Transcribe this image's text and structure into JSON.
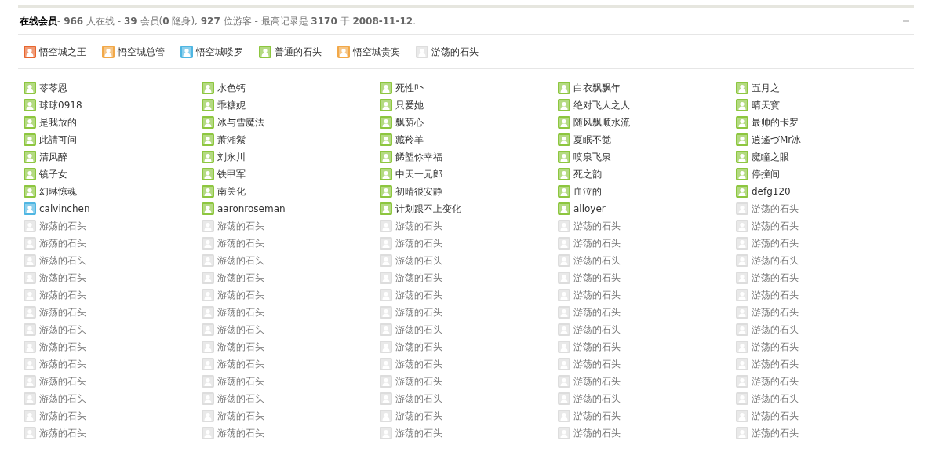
{
  "header": {
    "title": "在线会员",
    "summary": " - **966** 人在线 - **39** 会员(**0** 隐身), **927** 位游客 - 最高记录是 **3170** 于 **2008-11-12**."
  },
  "legend": [
    {
      "label": "悟空城之王",
      "color": "#e8662e"
    },
    {
      "label": "悟空城总管",
      "color": "#f2a848"
    },
    {
      "label": "悟空城喽罗",
      "color": "#4fb6e2"
    },
    {
      "label": "普通的石头",
      "color": "#8dc63f"
    },
    {
      "label": "悟空城贵宾",
      "color": "#f2a848"
    },
    {
      "label": "游荡的石头",
      "color": "#dddddd"
    }
  ],
  "members": [
    {
      "name": "苓苓恩",
      "color": "#8dc63f"
    },
    {
      "name": "水色钙",
      "color": "#8dc63f"
    },
    {
      "name": "死性卟",
      "color": "#8dc63f"
    },
    {
      "name": "白衣飘飘年",
      "color": "#8dc63f"
    },
    {
      "name": "五月之",
      "color": "#8dc63f"
    },
    {
      "name": "球球0918",
      "color": "#8dc63f"
    },
    {
      "name": "乖糖妮",
      "color": "#8dc63f"
    },
    {
      "name": "只爱她",
      "color": "#8dc63f"
    },
    {
      "name": "绝对飞人之人",
      "color": "#8dc63f"
    },
    {
      "name": "晴天寳",
      "color": "#8dc63f"
    },
    {
      "name": "是我放的",
      "color": "#8dc63f"
    },
    {
      "name": "冰与雪魔法",
      "color": "#8dc63f"
    },
    {
      "name": "飘荫心",
      "color": "#8dc63f"
    },
    {
      "name": "随风飘顺水流",
      "color": "#8dc63f"
    },
    {
      "name": "最帅的卡罗",
      "color": "#8dc63f"
    },
    {
      "name": "此請可问",
      "color": "#8dc63f"
    },
    {
      "name": "萧湘紫",
      "color": "#8dc63f"
    },
    {
      "name": "藏羚羊",
      "color": "#8dc63f"
    },
    {
      "name": "夏眠不觉",
      "color": "#8dc63f"
    },
    {
      "name": "逍遙づMr冰",
      "color": "#8dc63f"
    },
    {
      "name": "清风醉",
      "color": "#8dc63f"
    },
    {
      "name": "刘永川",
      "color": "#8dc63f"
    },
    {
      "name": "餙塱伱幸福",
      "color": "#8dc63f"
    },
    {
      "name": "喷泉飞泉",
      "color": "#8dc63f"
    },
    {
      "name": "魔瞳之眼",
      "color": "#8dc63f"
    },
    {
      "name": "镜子女",
      "color": "#8dc63f"
    },
    {
      "name": "铁甲军",
      "color": "#8dc63f"
    },
    {
      "name": "中天一元郎",
      "color": "#8dc63f"
    },
    {
      "name": "死之韵",
      "color": "#8dc63f"
    },
    {
      "name": "停撞间",
      "color": "#8dc63f"
    },
    {
      "name": "幻琳惊魂",
      "color": "#8dc63f"
    },
    {
      "name": "南关化",
      "color": "#8dc63f"
    },
    {
      "name": "初晴很安静",
      "color": "#8dc63f"
    },
    {
      "name": "血泣的",
      "color": "#8dc63f"
    },
    {
      "name": "defg120",
      "color": "#8dc63f"
    },
    {
      "name": "calvinchen",
      "color": "#4fb6e2"
    },
    {
      "name": "aaronroseman",
      "color": "#8dc63f"
    },
    {
      "name": "计划跟不上变化",
      "color": "#8dc63f"
    },
    {
      "name": "alloyer",
      "color": "#8dc63f"
    },
    {
      "name": "游荡的石头",
      "color": "#dddddd"
    },
    {
      "name": "游荡的石头",
      "color": "#dddddd"
    },
    {
      "name": "游荡的石头",
      "color": "#dddddd"
    },
    {
      "name": "游荡的石头",
      "color": "#dddddd"
    },
    {
      "name": "游荡的石头",
      "color": "#dddddd"
    },
    {
      "name": "游荡的石头",
      "color": "#dddddd"
    },
    {
      "name": "游荡的石头",
      "color": "#dddddd"
    },
    {
      "name": "游荡的石头",
      "color": "#dddddd"
    },
    {
      "name": "游荡的石头",
      "color": "#dddddd"
    },
    {
      "name": "游荡的石头",
      "color": "#dddddd"
    },
    {
      "name": "游荡的石头",
      "color": "#dddddd"
    },
    {
      "name": "游荡的石头",
      "color": "#dddddd"
    },
    {
      "name": "游荡的石头",
      "color": "#dddddd"
    },
    {
      "name": "游荡的石头",
      "color": "#dddddd"
    },
    {
      "name": "游荡的石头",
      "color": "#dddddd"
    },
    {
      "name": "游荡的石头",
      "color": "#dddddd"
    },
    {
      "name": "游荡的石头",
      "color": "#dddddd"
    },
    {
      "name": "游荡的石头",
      "color": "#dddddd"
    },
    {
      "name": "游荡的石头",
      "color": "#dddddd"
    },
    {
      "name": "游荡的石头",
      "color": "#dddddd"
    },
    {
      "name": "游荡的石头",
      "color": "#dddddd"
    },
    {
      "name": "游荡的石头",
      "color": "#dddddd"
    },
    {
      "name": "游荡的石头",
      "color": "#dddddd"
    },
    {
      "name": "游荡的石头",
      "color": "#dddddd"
    },
    {
      "name": "游荡的石头",
      "color": "#dddddd"
    },
    {
      "name": "游荡的石头",
      "color": "#dddddd"
    },
    {
      "name": "游荡的石头",
      "color": "#dddddd"
    },
    {
      "name": "游荡的石头",
      "color": "#dddddd"
    },
    {
      "name": "游荡的石头",
      "color": "#dddddd"
    },
    {
      "name": "游荡的石头",
      "color": "#dddddd"
    },
    {
      "name": "游荡的石头",
      "color": "#dddddd"
    },
    {
      "name": "游荡的石头",
      "color": "#dddddd"
    },
    {
      "name": "游荡的石头",
      "color": "#dddddd"
    },
    {
      "name": "游荡的石头",
      "color": "#dddddd"
    },
    {
      "name": "游荡的石头",
      "color": "#dddddd"
    },
    {
      "name": "游荡的石头",
      "color": "#dddddd"
    },
    {
      "name": "游荡的石头",
      "color": "#dddddd"
    },
    {
      "name": "游荡的石头",
      "color": "#dddddd"
    },
    {
      "name": "游荡的石头",
      "color": "#dddddd"
    },
    {
      "name": "游荡的石头",
      "color": "#dddddd"
    },
    {
      "name": "游荡的石头",
      "color": "#dddddd"
    },
    {
      "name": "游荡的石头",
      "color": "#dddddd"
    },
    {
      "name": "游荡的石头",
      "color": "#dddddd"
    },
    {
      "name": "游荡的石头",
      "color": "#dddddd"
    },
    {
      "name": "游荡的石头",
      "color": "#dddddd"
    },
    {
      "name": "游荡的石头",
      "color": "#dddddd"
    },
    {
      "name": "游荡的石头",
      "color": "#dddddd"
    },
    {
      "name": "游荡的石头",
      "color": "#dddddd"
    },
    {
      "name": "游荡的石头",
      "color": "#dddddd"
    },
    {
      "name": "游荡的石头",
      "color": "#dddddd"
    },
    {
      "name": "游荡的石头",
      "color": "#dddddd"
    },
    {
      "name": "游荡的石头",
      "color": "#dddddd"
    },
    {
      "name": "游荡的石头",
      "color": "#dddddd"
    },
    {
      "name": "游荡的石头",
      "color": "#dddddd"
    },
    {
      "name": "游荡的石头",
      "color": "#dddddd"
    },
    {
      "name": "游荡的石头",
      "color": "#dddddd"
    },
    {
      "name": "游荡的石头",
      "color": "#dddddd"
    },
    {
      "name": "游荡的石头",
      "color": "#dddddd"
    },
    {
      "name": "游荡的石头",
      "color": "#dddddd"
    },
    {
      "name": "游荡的石头",
      "color": "#dddddd"
    },
    {
      "name": "游荡的石头",
      "color": "#dddddd"
    },
    {
      "name": "游荡的石头",
      "color": "#dddddd"
    },
    {
      "name": "游荡的石头",
      "color": "#dddddd"
    },
    {
      "name": "游荡的石头",
      "color": "#dddddd"
    },
    {
      "name": "游荡的石头",
      "color": "#dddddd"
    },
    {
      "name": "游荡的石头",
      "color": "#dddddd"
    }
  ]
}
